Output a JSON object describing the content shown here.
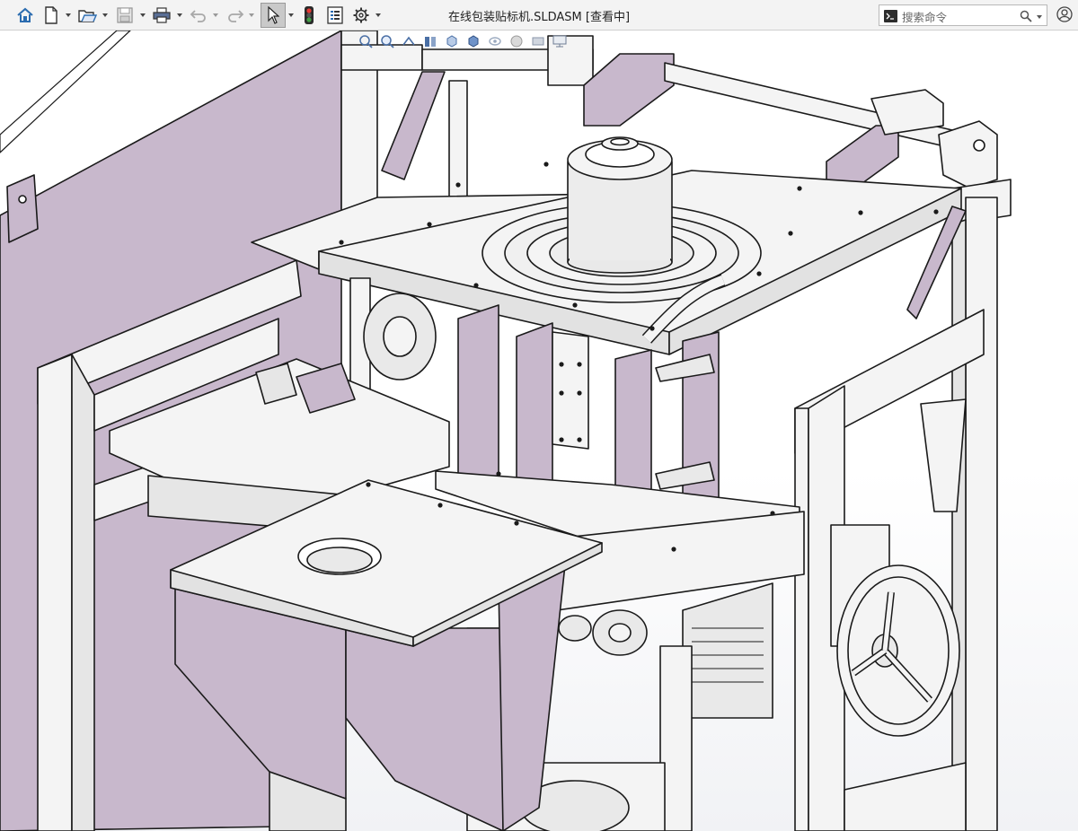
{
  "window": {
    "title": "在线包装贴标机.SLDASM [查看中]"
  },
  "toolbar": {
    "buttons": [
      {
        "name": "home-icon",
        "label": "home"
      },
      {
        "name": "new-document-icon",
        "label": "new"
      },
      {
        "name": "open-folder-icon",
        "label": "open"
      },
      {
        "name": "save-icon",
        "label": "save"
      },
      {
        "name": "print-icon",
        "label": "print"
      },
      {
        "name": "undo-icon",
        "label": "undo"
      },
      {
        "name": "redo-icon",
        "label": "redo"
      },
      {
        "name": "select-pointer-icon",
        "label": "select"
      },
      {
        "name": "rebuild-traffic-light-icon",
        "label": "rebuild"
      },
      {
        "name": "file-properties-icon",
        "label": "file properties"
      },
      {
        "name": "gear-icon",
        "label": "options"
      }
    ]
  },
  "search": {
    "placeholder": "搜索命令"
  },
  "colors": {
    "panel": "#c8b8cc",
    "panel_dark": "#b9a7bf",
    "steel": "#f4f4f4",
    "outline": "#1a1a1a",
    "select_active": "#c9c9c9"
  }
}
